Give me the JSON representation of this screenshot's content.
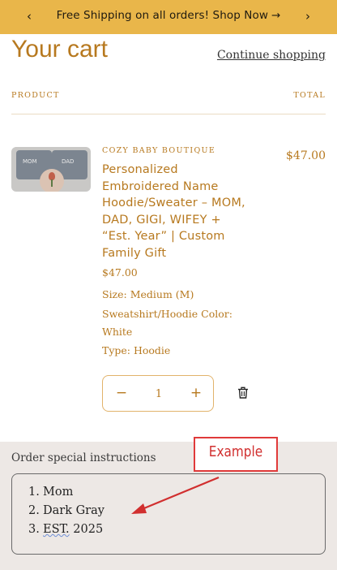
{
  "announcement": {
    "text": "Free Shipping on all orders! Shop Now",
    "arrow": "→",
    "prev_glyph": "‹",
    "next_glyph": "›"
  },
  "header": {
    "title": "Your cart",
    "continue_link": "Continue shopping"
  },
  "columns": {
    "product": "PRODUCT",
    "total": "TOTAL"
  },
  "item": {
    "vendor": "COZY BABY BOUTIQUE",
    "name": "Personalized Embroidered Name Hoodie/Sweater – MOM, DAD, GIGI, WIFEY + “Est. Year” | Custom Family Gift",
    "unit_price": "$47.00",
    "line_total": "$47.00",
    "options": [
      "Size: Medium (M)",
      "Sweatshirt/Hoodie Color: White",
      "Type: Hoodie"
    ],
    "quantity": "1",
    "thumbnail_tags": [
      "MOM",
      "DAD"
    ]
  },
  "instructions": {
    "label": "Order special instructions",
    "lines": [
      {
        "num": "1.",
        "text": "Mom"
      },
      {
        "num": "2.",
        "text": "Dark Gray"
      },
      {
        "num": "3.",
        "first": "EST.",
        "rest": " 2025"
      }
    ]
  },
  "annotation": {
    "label": "Example",
    "color": "#d12f2f"
  },
  "colors": {
    "brand": "#b7791f",
    "announcement_bg": "#e9b64a",
    "instructions_bg": "#ede8e5"
  },
  "icons": {
    "prev": "chevron-left-icon",
    "next": "chevron-right-icon",
    "delete": "trash-icon",
    "minus": "minus-icon",
    "plus": "plus-icon"
  }
}
